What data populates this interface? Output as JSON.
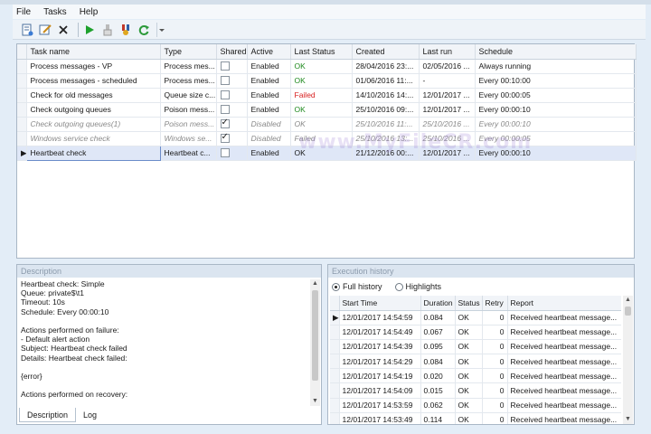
{
  "menu": {
    "file": "File",
    "tasks": "Tasks",
    "help": "Help"
  },
  "toolbar": {
    "icons": [
      "new-task-icon",
      "edit-task-icon",
      "delete-icon",
      "run-icon",
      "stop-icon",
      "shared-icon",
      "refresh-icon",
      "toolbar-dropdown-icon"
    ]
  },
  "tasks": {
    "columns": [
      "Task name",
      "Type",
      "Shared",
      "Active",
      "Last Status",
      "Created",
      "Last run",
      "Schedule"
    ],
    "rows": [
      {
        "name": "Process messages - VP",
        "type": "Process mes...",
        "shared": false,
        "active": "Enabled",
        "status": "OK",
        "created": "28/04/2016 23:...",
        "last_run": "02/05/2016 ...",
        "schedule": "Always running"
      },
      {
        "name": "Process messages - scheduled",
        "type": "Process mes...",
        "shared": false,
        "active": "Enabled",
        "status": "OK",
        "created": "01/06/2016 11:...",
        "last_run": "-",
        "schedule": "Every 00:10:00"
      },
      {
        "name": "Check for old messages",
        "type": "Queue size c...",
        "shared": false,
        "active": "Enabled",
        "status": "Failed",
        "created": "14/10/2016 14:...",
        "last_run": "12/01/2017 ...",
        "schedule": "Every 00:00:05"
      },
      {
        "name": "Check outgoing queues",
        "type": "Poison mess...",
        "shared": false,
        "active": "Enabled",
        "status": "OK",
        "created": "25/10/2016 09:...",
        "last_run": "12/01/2017 ...",
        "schedule": "Every 00:00:10"
      },
      {
        "name": "Check outgoing queues(1)",
        "type": "Poison mess...",
        "shared": true,
        "active": "Disabled",
        "status": "OK",
        "created": "25/10/2016 11:...",
        "last_run": "25/10/2016 ...",
        "schedule": "Every 00:00:10"
      },
      {
        "name": "Windows service check",
        "type": "Windows se...",
        "shared": true,
        "active": "Disabled",
        "status": "Failed",
        "created": "25/10/2016 13:...",
        "last_run": "25/10/2016 ...",
        "schedule": "Every 00:00:05"
      },
      {
        "name": "Heartbeat check",
        "type": "Heartbeat c...",
        "shared": false,
        "active": "Enabled",
        "status": "OK",
        "created": "21/12/2016 00:...",
        "last_run": "12/01/2017 ...",
        "schedule": "Every 00:00:10",
        "selected": true
      }
    ]
  },
  "watermark": "www.MyFileCR.com",
  "description": {
    "title": "Description",
    "lines": [
      "Heartbeat check: Simple",
      "Queue: private$\\t1",
      "Timeout: 10s",
      "Schedule: Every 00:00:10",
      "",
      "Actions performed on failure:",
      "- Default alert action",
      "Subject: Heartbeat check failed",
      "Details: Heartbeat check failed:",
      "",
      "{error}",
      "",
      "Actions performed on recovery:"
    ],
    "tabs": [
      "Description",
      "Log"
    ]
  },
  "history": {
    "title": "Execution history",
    "radio_full": "Full history",
    "radio_highlights": "Highlights",
    "columns": [
      "Start Time",
      "Duration",
      "Status",
      "Retry",
      "Report"
    ],
    "rows": [
      {
        "start": "12/01/2017 14:54:59",
        "duration": "0.084",
        "status": "OK",
        "retry": "0",
        "report": "Received heartbeat message..."
      },
      {
        "start": "12/01/2017 14:54:49",
        "duration": "0.067",
        "status": "OK",
        "retry": "0",
        "report": "Received heartbeat message..."
      },
      {
        "start": "12/01/2017 14:54:39",
        "duration": "0.095",
        "status": "OK",
        "retry": "0",
        "report": "Received heartbeat message..."
      },
      {
        "start": "12/01/2017 14:54:29",
        "duration": "0.084",
        "status": "OK",
        "retry": "0",
        "report": "Received heartbeat message..."
      },
      {
        "start": "12/01/2017 14:54:19",
        "duration": "0.020",
        "status": "OK",
        "retry": "0",
        "report": "Received heartbeat message..."
      },
      {
        "start": "12/01/2017 14:54:09",
        "duration": "0.015",
        "status": "OK",
        "retry": "0",
        "report": "Received heartbeat message..."
      },
      {
        "start": "12/01/2017 14:53:59",
        "duration": "0.062",
        "status": "OK",
        "retry": "0",
        "report": "Received heartbeat message..."
      },
      {
        "start": "12/01/2017 14:53:49",
        "duration": "0.114",
        "status": "OK",
        "retry": "0",
        "report": "Received heartbeat message..."
      }
    ]
  },
  "colors": {
    "ok": "#1f8a1f",
    "failed": "#d81e1e",
    "selection": "#dfe7f7",
    "panel_title": "#dbe5f0"
  }
}
